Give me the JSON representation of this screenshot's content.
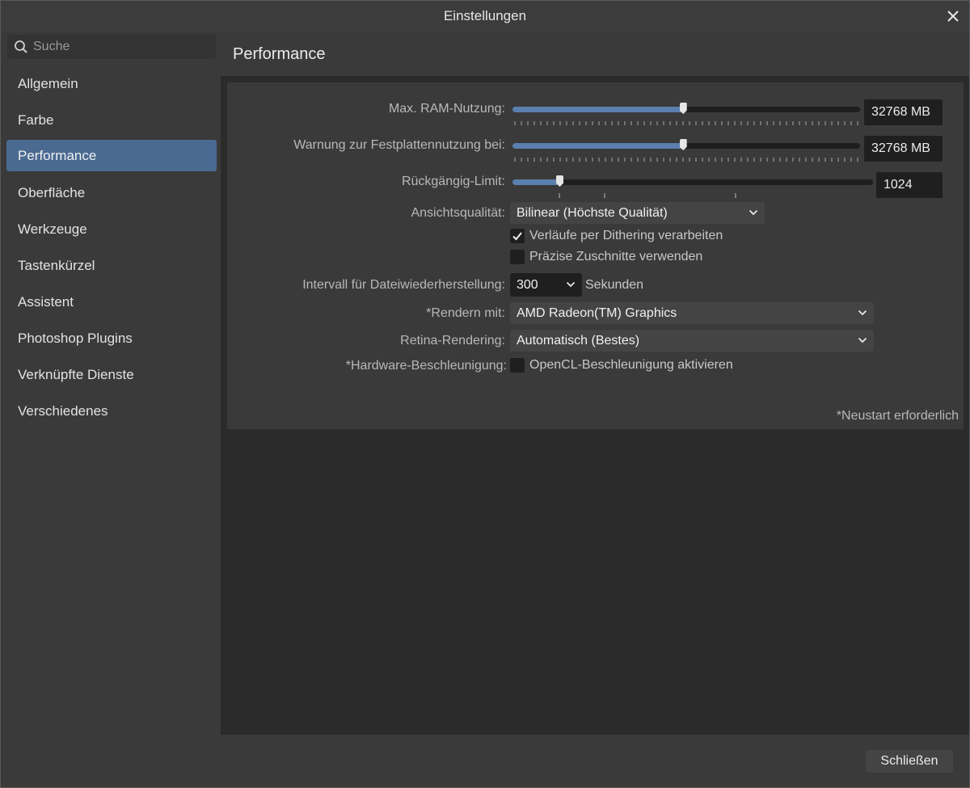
{
  "window": {
    "title": "Einstellungen"
  },
  "search": {
    "placeholder": "Suche"
  },
  "sidebar": {
    "items": [
      {
        "label": "Allgemein"
      },
      {
        "label": "Farbe"
      },
      {
        "label": "Performance",
        "active": true
      },
      {
        "label": "Oberfläche"
      },
      {
        "label": "Werkzeuge"
      },
      {
        "label": "Tastenkürzel"
      },
      {
        "label": "Assistent"
      },
      {
        "label": "Photoshop Plugins"
      },
      {
        "label": "Verknüpfte Dienste"
      },
      {
        "label": "Verschiedenes"
      }
    ]
  },
  "page": {
    "title": "Performance"
  },
  "settings": {
    "ram": {
      "label": "Max. RAM-Nutzung:",
      "value": "32768 MB",
      "level": 0.49
    },
    "disk_warning": {
      "label": "Warnung zur Festplattennutzung bei:",
      "value": "32768 MB",
      "level": 0.49
    },
    "undo_limit": {
      "label": "Rückgängig-Limit:",
      "value": "1024",
      "level": 0.13
    },
    "view_quality": {
      "label": "Ansichtsqualität:",
      "value": "Bilinear (Höchste Qualität)"
    },
    "dithering": {
      "label": "Verläufe per Dithering verarbeiten",
      "checked": true
    },
    "precise_clipping": {
      "label": "Präzise Zuschnitte verwenden",
      "checked": false
    },
    "recovery_interval": {
      "label": "Intervall für Dateiwiederherstellung:",
      "value": "300",
      "unit": "Sekunden"
    },
    "renderer": {
      "label": "*Rendern mit:",
      "value": "AMD Radeon(TM) Graphics"
    },
    "retina": {
      "label": "Retina-Rendering:",
      "value": "Automatisch (Bestes)"
    },
    "hardware_accel": {
      "label": "*Hardware-Beschleunigung:",
      "option": "OpenCL-Beschleunigung aktivieren",
      "checked": false
    }
  },
  "note": "*Neustart erforderlich",
  "footer": {
    "close_label": "Schließen"
  },
  "colors": {
    "accent": "#4a6a92",
    "slider_fill": "#5b7fae",
    "background": "#3a3a3a"
  },
  "icons": {
    "search": "search-icon",
    "close": "close-icon",
    "chevron": "chevron-down-icon",
    "check": "check-icon"
  }
}
